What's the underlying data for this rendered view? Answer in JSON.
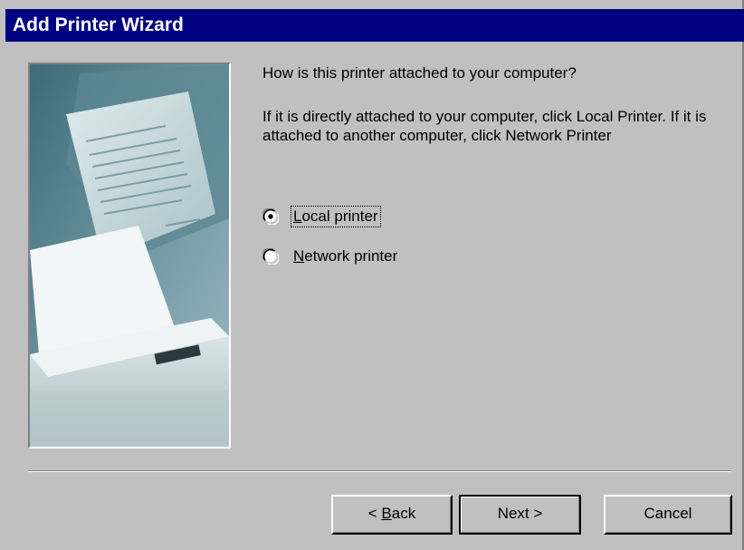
{
  "window": {
    "title": "Add Printer Wizard"
  },
  "content": {
    "prompt": "How is this printer attached to your computer?",
    "hint": "If it is directly attached to your computer, click Local Printer. If it is attached to another computer, click Network Printer",
    "options": [
      {
        "label_prefix": "",
        "label_key": "L",
        "label_rest": "ocal printer",
        "selected": true
      },
      {
        "label_prefix": "",
        "label_key": "N",
        "label_rest": "etwork printer",
        "selected": false
      }
    ]
  },
  "buttons": {
    "back_prefix": "< ",
    "back_key": "B",
    "back_rest": "ack",
    "next": "Next >",
    "cancel": "Cancel"
  },
  "colors": {
    "titlebar": "#000080",
    "face": "#c0c0c0"
  },
  "icons": {
    "illustration": "printer-illustration"
  }
}
